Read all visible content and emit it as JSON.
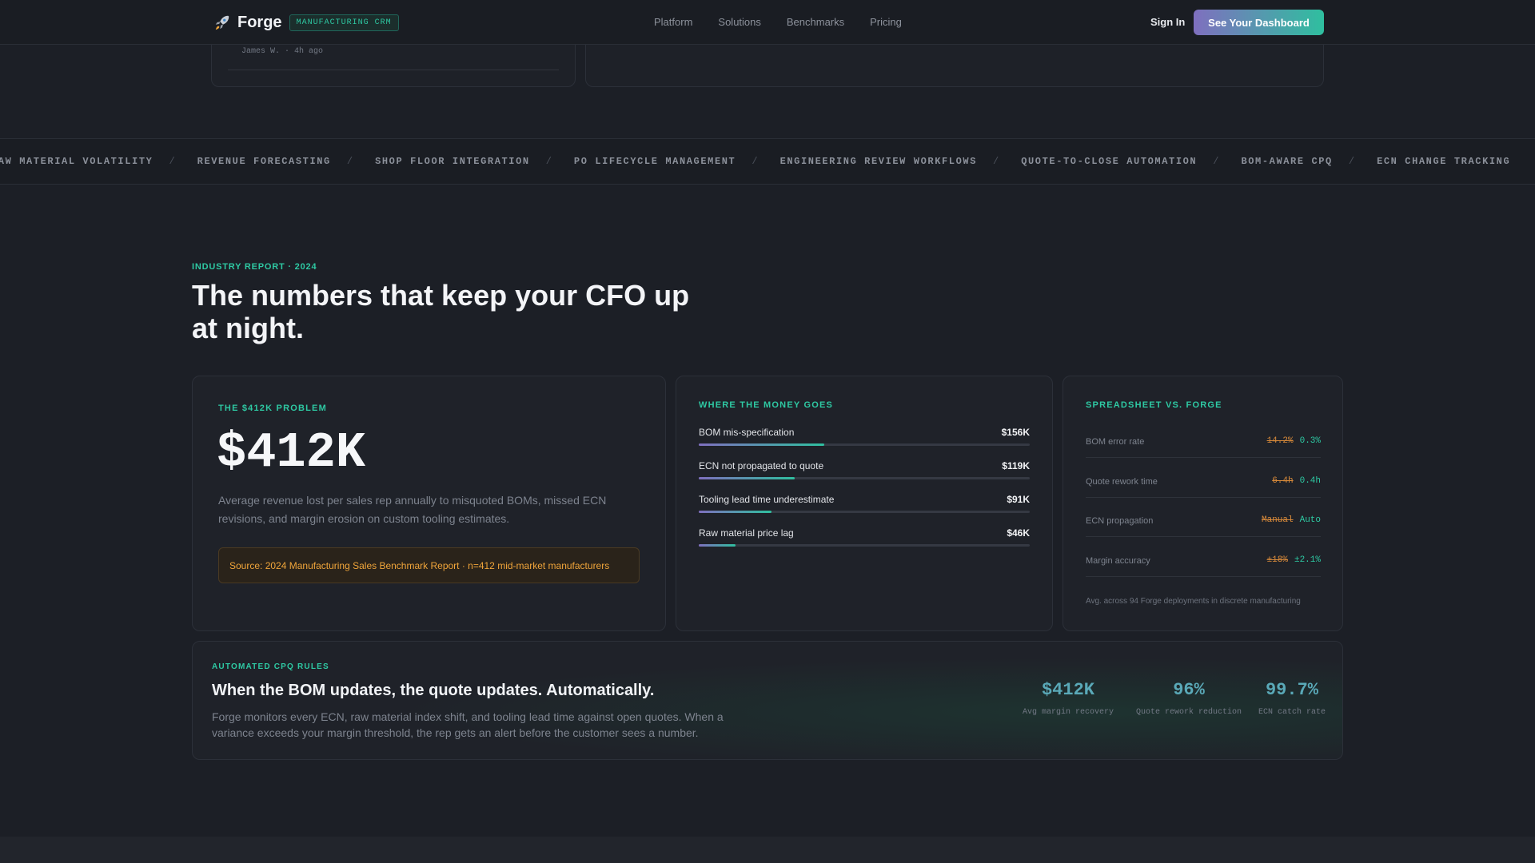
{
  "nav": {
    "brand": "Forge",
    "tag": "MANUFACTURING CRM",
    "links": [
      "Platform",
      "Solutions",
      "Benchmarks",
      "Pricing"
    ],
    "signin": "Sign In",
    "cta": "See Your Dashboard"
  },
  "top_card": {
    "meta": "James W. · 4h ago"
  },
  "marquee": {
    "items": [
      "RAW MATERIAL VOLATILITY",
      "REVENUE FORECASTING",
      "SHOP FLOOR INTEGRATION",
      "PO LIFECYCLE MANAGEMENT",
      "ENGINEERING REVIEW WORKFLOWS",
      "QUOTE-TO-CLOSE AUTOMATION",
      "BOM-AWARE CPQ",
      "ECN CHANGE TRACKING"
    ],
    "separator": "/"
  },
  "section": {
    "eyebrow": "INDUSTRY REPORT · 2024",
    "title": "The numbers that keep your CFO up at night."
  },
  "problem": {
    "eyebrow": "THE $412K PROBLEM",
    "value": "$412K",
    "description": "Average revenue lost per sales rep annually to misquoted BOMs, missed ECN revisions, and margin erosion on custom tooling estimates.",
    "source": "Source: 2024 Manufacturing Sales Benchmark Report · n=412 mid-market manufacturers"
  },
  "money": {
    "eyebrow": "WHERE THE MONEY GOES",
    "rows": [
      {
        "label": "BOM mis-specification",
        "value": "$156K",
        "fraction": 0.38
      },
      {
        "label": "ECN not propagated to quote",
        "value": "$119K",
        "fraction": 0.29
      },
      {
        "label": "Tooling lead time underestimate",
        "value": "$91K",
        "fraction": 0.22
      },
      {
        "label": "Raw material price lag",
        "value": "$46K",
        "fraction": 0.11
      }
    ]
  },
  "compare": {
    "eyebrow": "SPREADSHEET VS. FORGE",
    "rows": [
      {
        "label": "BOM error rate",
        "old": "14.2%",
        "new": "0.3%"
      },
      {
        "label": "Quote rework time",
        "old": "6.4h",
        "new": "0.4h"
      },
      {
        "label": "ECN propagation",
        "old": "Manual",
        "new": "Auto"
      },
      {
        "label": "Margin accuracy",
        "old": "±18%",
        "new": "±2.1%"
      }
    ],
    "note": "Avg. across 94 Forge deployments in discrete manufacturing"
  },
  "cpq": {
    "eyebrow": "AUTOMATED CPQ RULES",
    "title": "When the BOM updates, the quote updates. Automatically.",
    "description": "Forge monitors every ECN, raw material index shift, and tooling lead time against open quotes. When a variance exceeds your margin threshold, the rep gets an alert before the customer sees a number.",
    "stats": [
      {
        "value": "$412K",
        "label": "Avg margin recovery"
      },
      {
        "value": "96%",
        "label": "Quote rework reduction"
      },
      {
        "value": "99.7%",
        "label": "ECN catch rate"
      }
    ]
  },
  "colors": {
    "accent": "#2ec9a3",
    "accent_purple": "#7f6fbf",
    "warning": "#f0a53a",
    "background": "#1c1f26"
  }
}
